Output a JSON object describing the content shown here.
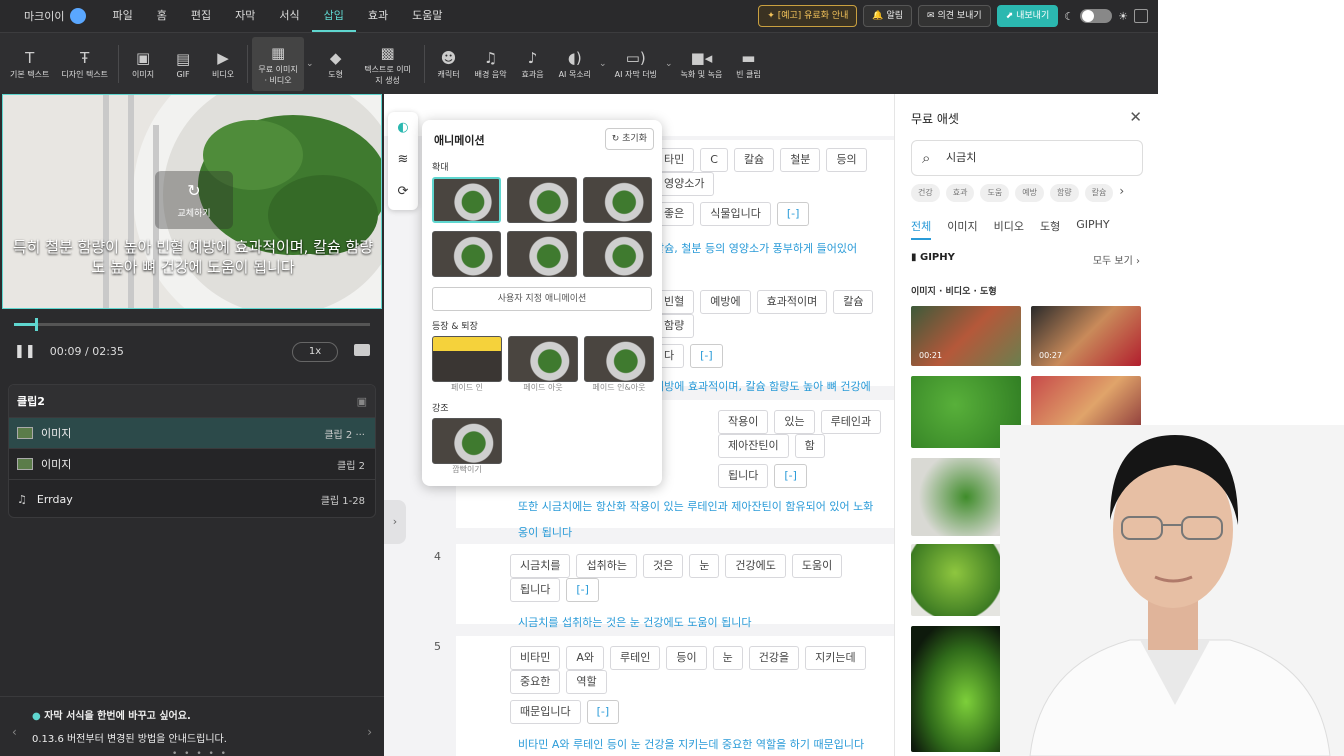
{
  "menubar": {
    "brand": "마크이이",
    "items": [
      "파일",
      "홈",
      "편집",
      "자막",
      "서식",
      "삽입",
      "효과",
      "도움말"
    ],
    "active_index": 5,
    "notice_btn": "[예고] 유료화 안내",
    "alarm_btn": "알림",
    "feedback_btn": "의견 보내기",
    "export_btn": "내보내기"
  },
  "toolbar": {
    "items": [
      {
        "label": "기본 텍스트",
        "icon": "text-icon"
      },
      {
        "label": "디자인 텍스트",
        "icon": "design-text-icon"
      },
      {
        "label": "이미지",
        "icon": "image-icon"
      },
      {
        "label": "GIF",
        "icon": "gif-icon"
      },
      {
        "label": "비디오",
        "icon": "video-icon"
      },
      {
        "label": "무료 이미지 · 비디오",
        "icon": "free-media-icon"
      },
      {
        "label": "도형",
        "icon": "shape-icon"
      },
      {
        "label": "텍스트로 이미지 생성",
        "icon": "text-to-image-icon"
      },
      {
        "label": "캐릭터",
        "icon": "character-icon"
      },
      {
        "label": "배경 음악",
        "icon": "music-icon"
      },
      {
        "label": "효과음",
        "icon": "sound-effect-icon"
      },
      {
        "label": "AI 목소리",
        "icon": "ai-voice-icon"
      },
      {
        "label": "AI 자막 더빙",
        "icon": "ai-dubbing-icon"
      },
      {
        "label": "녹화 및 녹음",
        "icon": "record-icon"
      },
      {
        "label": "빈 클립",
        "icon": "blank-clip-icon"
      }
    ]
  },
  "preview": {
    "caption_line1": "특히 철분 함량이 높아 빈혈 예방에 효과적이며, 칼슘 함량",
    "caption_line2": "도 높아 뼈 건강에 도움이 됩니다",
    "replace_label": "교체하기",
    "time": "00:09 / 02:35",
    "speed": "1x",
    "progress": 0.06
  },
  "clips": {
    "header": "클립2",
    "rows": [
      {
        "name": "이미지",
        "info": "클립 2",
        "selected": true
      },
      {
        "name": "이미지",
        "info": "클립 2",
        "selected": false
      },
      {
        "name": "Errday",
        "info": "클립 1-28",
        "selected": false
      }
    ]
  },
  "notice": {
    "title": "자막 서식을 한번에 바꾸고 싶어요.",
    "body": "0.13.6 버전부터 변경된 방법을 안내드립니다."
  },
  "animation_panel": {
    "title": "애니메이션",
    "reset": "초기화",
    "section_zoom": "확대",
    "custom_btn": "사용자 지정 애니메이션",
    "section_enter_exit": "등장 & 퇴장",
    "enter_exit_items": [
      "페이드 인",
      "페이드 아웃",
      "페이드 인&아웃"
    ],
    "section_emphasis": "강조",
    "emphasis_items": [
      "깜빡이기"
    ]
  },
  "script": {
    "row1_chips": [
      "타민",
      "C",
      "칼슘",
      "철분",
      "등의",
      "영양소가"
    ],
    "row1b_chips": [
      "좋은",
      "식물입니다",
      "[-]"
    ],
    "row1_sentence": "칼슘, 철분 등의 영양소가 풍부하게 들어있어",
    "row2_chips": [
      "빈혈",
      "예방에",
      "효과적이며",
      "칼슘",
      "함량"
    ],
    "row2b_chips": [
      "다",
      "[-]"
    ],
    "row2_sentence": "예방에 효과적이며, 칼슘 함량도 높아 뼈 건강에",
    "row3_chips": [
      "작용이",
      "있는",
      "루테인과",
      "제아잔틴이",
      "함"
    ],
    "row3b_chips": [
      "됩니다",
      "[-]"
    ],
    "row3_sentence_1": "또한 시금치에는 항산화 작용이 있는 루테인과 제아잔틴이 함유되어 있어 노화",
    "row3_sentence_2": "옹이 됩니다",
    "row4_num": "4",
    "row4_chips": [
      "시금치를",
      "섭취하는",
      "것은",
      "눈",
      "건강에도",
      "도움이",
      "됩니다",
      "[-]"
    ],
    "row4_sentence": "시금치를 섭취하는 것은 눈 건강에도 도움이 됩니다",
    "row5_num": "5",
    "row5_chips": [
      "비타민",
      "A와",
      "루테인",
      "등이",
      "눈",
      "건강을",
      "지키는데",
      "중요한",
      "역할"
    ],
    "row5b_chips": [
      "때문입니다",
      "[-]"
    ],
    "row5_sentence": "비타민 A와 루테인 등이 눈 건강을 지키는데 중요한 역할을 하기 때문입니다"
  },
  "assets": {
    "title": "무료 애셋",
    "search_value": "시금치",
    "tags": [
      "건강",
      "효과",
      "도움",
      "예방",
      "함량",
      "칼슘"
    ],
    "tabs": [
      "전체",
      "이미지",
      "비디오",
      "도형",
      "GIPHY"
    ],
    "giphy_label": "GIPHY",
    "see_all": "모두 보기",
    "mix_header": "이미지 · 비디오 · 도형",
    "durations": [
      "00:21",
      "00:27"
    ]
  }
}
